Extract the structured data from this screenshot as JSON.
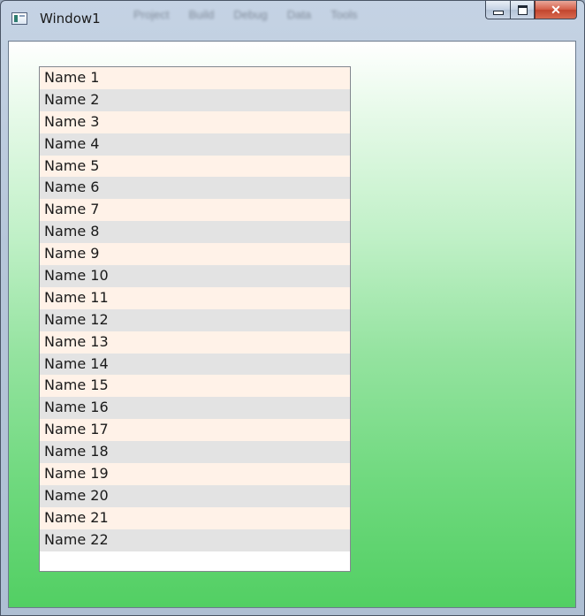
{
  "window": {
    "title": "Window1",
    "icon": "app-window-icon",
    "caption_buttons": {
      "minimize_icon": "minimize-icon",
      "maximize_icon": "maximize-icon",
      "close_label": "✕"
    },
    "background_menu": [
      "Project",
      "Build",
      "Debug",
      "Data",
      "Tools"
    ]
  },
  "colors": {
    "gradient_top": "#ffffff",
    "gradient_bottom": "#52cf63",
    "row_odd": "#fff2e8",
    "row_even": "#e3e3e3"
  },
  "listbox": {
    "items": [
      {
        "label": "Name 1"
      },
      {
        "label": "Name 2"
      },
      {
        "label": "Name 3"
      },
      {
        "label": "Name 4"
      },
      {
        "label": "Name 5"
      },
      {
        "label": "Name 6"
      },
      {
        "label": "Name 7"
      },
      {
        "label": "Name 8"
      },
      {
        "label": "Name 9"
      },
      {
        "label": "Name 10"
      },
      {
        "label": "Name 11"
      },
      {
        "label": "Name 12"
      },
      {
        "label": "Name 13"
      },
      {
        "label": "Name 14"
      },
      {
        "label": "Name 15"
      },
      {
        "label": "Name 16"
      },
      {
        "label": "Name 17"
      },
      {
        "label": "Name 18"
      },
      {
        "label": "Name 19"
      },
      {
        "label": "Name 20"
      },
      {
        "label": "Name 21"
      },
      {
        "label": "Name 22"
      }
    ]
  }
}
